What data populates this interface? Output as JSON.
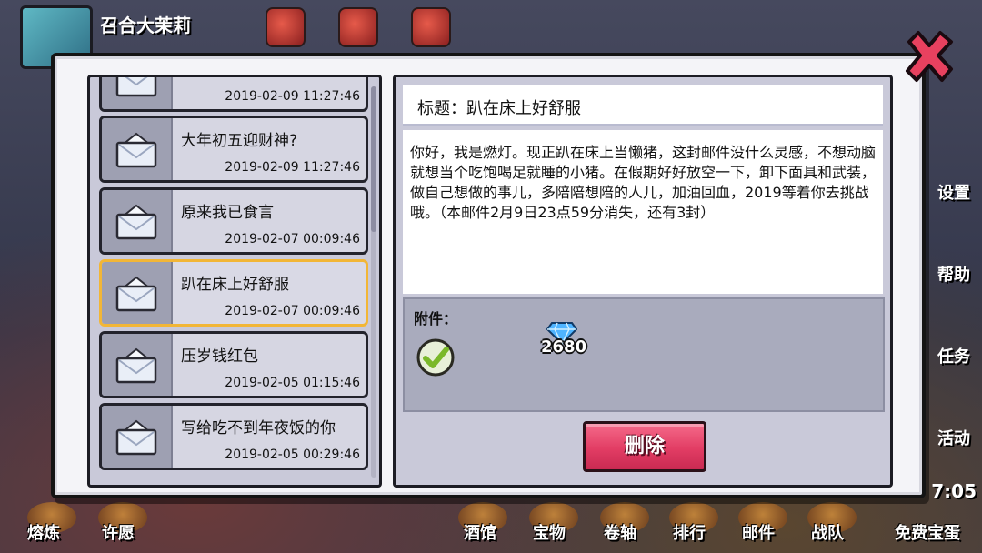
{
  "player": {
    "name": "召合大茉莉"
  },
  "side_menu": [
    "设置",
    "帮助",
    "任务",
    "活动"
  ],
  "clock": "7:05",
  "bottom_nav": [
    "熔炼",
    "许愿",
    "酒馆",
    "宝物",
    "卷轴",
    "排行",
    "邮件",
    "战队",
    "免费宝蛋"
  ],
  "mail_list": [
    {
      "title": "",
      "date": "2019-02-09 11:27:46"
    },
    {
      "title": "大年初五迎财神?",
      "date": "2019-02-09 11:27:46"
    },
    {
      "title": "原来我已食言",
      "date": "2019-02-07 00:09:46"
    },
    {
      "title": "趴在床上好舒服",
      "date": "2019-02-07 00:09:46",
      "selected": true
    },
    {
      "title": "压岁钱红包",
      "date": "2019-02-05 01:15:46"
    },
    {
      "title": "写给吃不到年夜饭的你",
      "date": "2019-02-05 00:29:46"
    }
  ],
  "detail": {
    "subject": "标题：趴在床上好舒服",
    "body": "你好，我是燃灯。现正趴在床上当懒猪，这封邮件没什么灵感，不想动脑就想当个吃饱喝足就睡的小猪。在假期好好放空一下，卸下面具和武装，做自己想做的事儿，多陪陪想陪的人儿，加油回血，2019等着你去挑战哦。（本邮件2月9日23点59分消失，还有3封）",
    "attachment_label": "附件：",
    "attachment": {
      "icon": "diamond-icon",
      "count": "2680",
      "claimed": true
    }
  },
  "buttons": {
    "delete": "删除"
  },
  "colors": {
    "selected_border": "#f2b636",
    "delete_button": "#e23d64",
    "close_x": "#e8415f"
  }
}
